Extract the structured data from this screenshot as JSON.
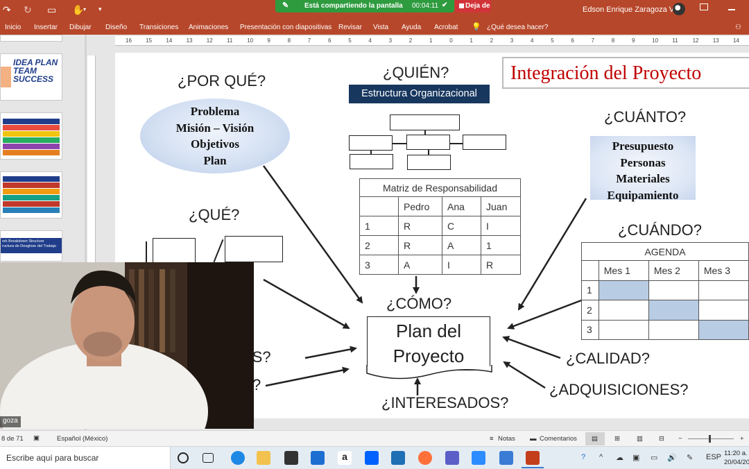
{
  "titlebar": {
    "share_label": "Está compartiendo la pantalla",
    "share_time": "00:04:11",
    "stop_share_label": "Deja de",
    "user_name": "Edson Enrique Zaragoza Vera"
  },
  "ribbon": {
    "tabs": [
      "Inicio",
      "Insertar",
      "Dibujar",
      "Diseño",
      "Transiciones",
      "Animaciones",
      "Presentación con diapositivas",
      "Revisar",
      "Vista",
      "Ayuda",
      "Acrobat",
      "¿Qué desea hacer?"
    ]
  },
  "thumbnails": {
    "thumb1_text": "IDEA PLAN TEAM SUCCESS",
    "thumb4_lines": [
      "ork Breakdown Structure",
      "ructura de Desglose del Trabajo"
    ]
  },
  "ruler_numbers": [
    "16",
    "15",
    "14",
    "13",
    "12",
    "11",
    "10",
    "9",
    "8",
    "7",
    "6",
    "5",
    "4",
    "3",
    "2",
    "1",
    "0",
    "1",
    "2",
    "3",
    "4",
    "5",
    "6",
    "7",
    "8",
    "9",
    "10",
    "11",
    "12",
    "13",
    "14",
    "15",
    "16"
  ],
  "slide": {
    "title": "Integración del Proyecto",
    "por_que": "¿POR QUÉ?",
    "por_que_items": [
      "Problema",
      "Misión – Visión",
      "Objetivos",
      "Plan"
    ],
    "quien": "¿QUIÉN?",
    "quien_banner": "Estructura Organizacional",
    "cuanto": "¿CUÁNTO?",
    "cuanto_items": [
      "Presupuesto",
      "Personas",
      "Materiales",
      "Equipamiento"
    ],
    "que": "¿QUÉ?",
    "matrix": {
      "title": "Matriz de Responsabilidad",
      "headers": [
        "",
        "Pedro",
        "Ana",
        "Juan"
      ],
      "rows": [
        [
          "1",
          "R",
          "C",
          "I"
        ],
        [
          "2",
          "R",
          "A",
          "1"
        ],
        [
          "3",
          "A",
          "I",
          "R"
        ]
      ]
    },
    "cuando": "¿CUÁNDO?",
    "agenda": {
      "title": "AGENDA",
      "headers": [
        "",
        "Mes 1",
        "Mes 2",
        "Mes 3"
      ],
      "rows": [
        "1",
        "2",
        "3"
      ]
    },
    "como": "¿CÓMO?",
    "plan_lines": [
      "Plan del",
      "Proyecto"
    ],
    "comunicaciones": "ONES?",
    "riesgos": "?",
    "calidad": "¿CALIDAD?",
    "adquisiciones": "¿ADQUISICIONES?",
    "interesados": "¿INTERESADOS?"
  },
  "webcam": {
    "name_tag": "goza"
  },
  "statusbar": {
    "slide_count": "8 de 71",
    "language": "Español (México)",
    "notes": "Notas",
    "comments": "Comentarios"
  },
  "taskbar": {
    "search_placeholder": "Escribe aquí para buscar",
    "lang": "ESP",
    "time": "11:20 a.",
    "date": "20/04/20"
  },
  "colors": {
    "ppt_red": "#b7472a",
    "share_green": "#2e9b3f",
    "title_red": "#c00000",
    "banner_navy": "#17375e",
    "agenda_blue": "#b8cce4"
  }
}
